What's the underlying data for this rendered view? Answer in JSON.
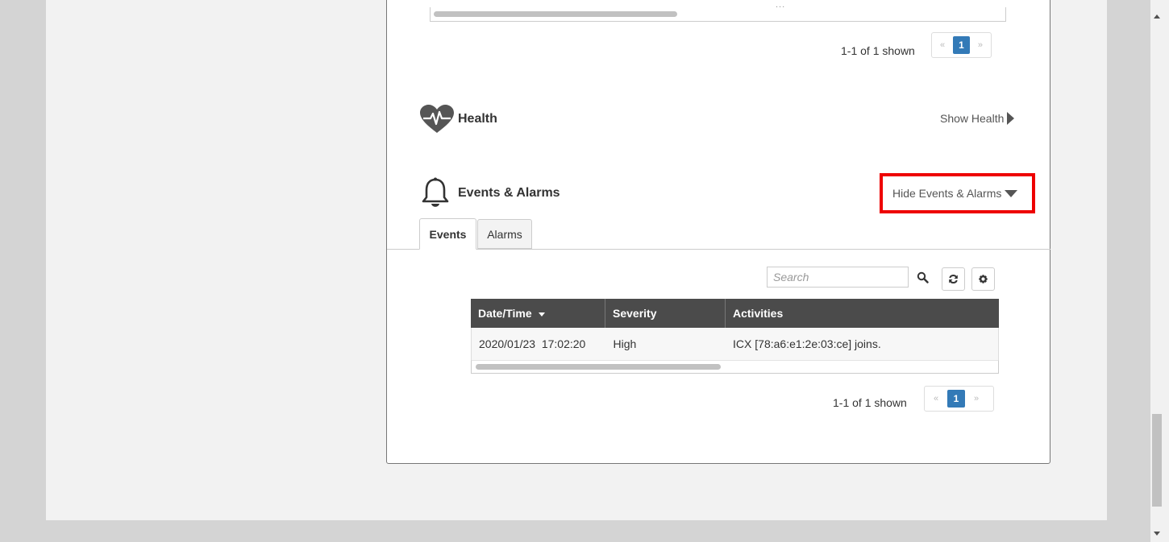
{
  "top_table": {
    "cut_text": "...",
    "pager_summary": "1-1 of 1 shown",
    "pager": {
      "prev": "«",
      "page": "1",
      "next": "»"
    }
  },
  "health": {
    "title": "Health",
    "toggle_label": "Show Health"
  },
  "events_alarms": {
    "title": "Events & Alarms",
    "toggle_label": "Hide Events & Alarms",
    "tabs": [
      {
        "label": "Events",
        "active": true
      },
      {
        "label": "Alarms",
        "active": false
      }
    ],
    "search": {
      "placeholder": "Search",
      "value": ""
    },
    "toolbar": {
      "refresh_icon": "refresh-icon",
      "settings_icon": "gear-icon"
    },
    "table": {
      "columns": [
        "Date/Time",
        "Severity",
        "Activities"
      ],
      "sort_column": "Date/Time",
      "rows": [
        [
          "2020/01/23  17:02:20",
          "High",
          "ICX [78:a6:e1:2e:03:ce] joins."
        ]
      ]
    },
    "pager_summary": "1-1 of 1 shown",
    "pager": {
      "prev": "«",
      "page": "1",
      "next": "»"
    }
  },
  "colors": {
    "accent": "#337ab7",
    "header_bg": "#4b4b4b",
    "highlight": "#ee0000"
  }
}
